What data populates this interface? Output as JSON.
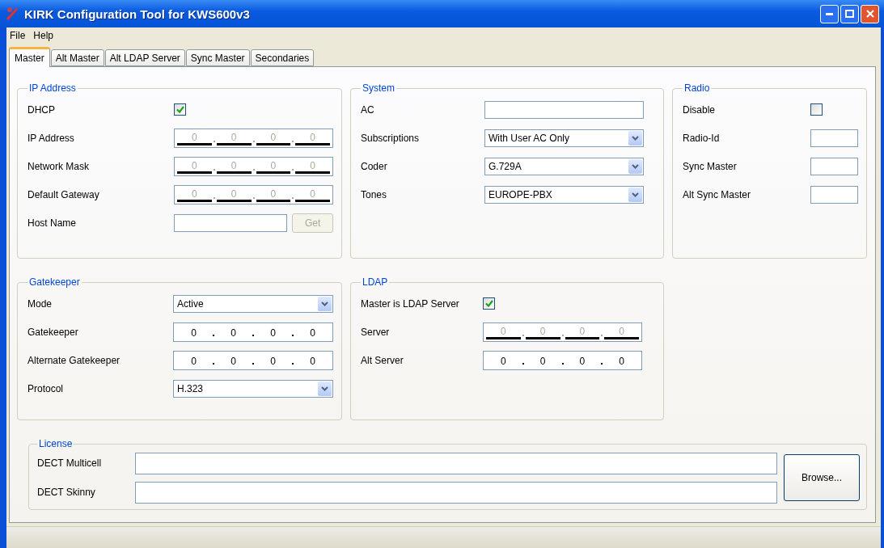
{
  "window": {
    "title": "KIRK Configuration Tool for KWS600v3"
  },
  "menu": [
    "File",
    "Help"
  ],
  "tabs": [
    {
      "label": "Master",
      "selected": true
    },
    {
      "label": "Alt Master",
      "selected": false
    },
    {
      "label": "Alt LDAP Server",
      "selected": false
    },
    {
      "label": "Sync Master",
      "selected": false
    },
    {
      "label": "Secondaries",
      "selected": false
    }
  ],
  "groups": [
    {
      "title": "IP Address",
      "rows": [
        {
          "kind": "checkbox",
          "label": "DHCP",
          "checked": true
        },
        {
          "kind": "ip",
          "label": "IP Address",
          "disabled": true,
          "octets": [
            "0",
            "0",
            "0",
            "0"
          ]
        },
        {
          "kind": "ip",
          "label": "Network Mask",
          "disabled": true,
          "octets": [
            "0",
            "0",
            "0",
            "0"
          ]
        },
        {
          "kind": "ip",
          "label": "Default Gateway",
          "disabled": true,
          "octets": [
            "0",
            "0",
            "0",
            "0"
          ]
        },
        {
          "kind": "text",
          "label": "Host Name",
          "button": {
            "label": "Get",
            "disabled": true
          }
        }
      ]
    },
    {
      "title": "System",
      "rows": [
        {
          "kind": "text",
          "label": "AC"
        },
        {
          "kind": "select",
          "label": "Subscriptions",
          "value": "With User AC Only"
        },
        {
          "kind": "select",
          "label": "Coder",
          "value": "G.729A"
        },
        {
          "kind": "select",
          "label": "Tones",
          "value": "EUROPE-PBX"
        }
      ]
    },
    {
      "title": "Radio",
      "rows": [
        {
          "kind": "checkbox",
          "label": "Disable",
          "checked": false
        },
        {
          "kind": "small",
          "label": "Radio-Id"
        },
        {
          "kind": "small",
          "label": "Sync Master"
        },
        {
          "kind": "small",
          "label": "Alt Sync Master"
        }
      ]
    },
    {
      "title": "Gatekeeper",
      "rows": [
        {
          "kind": "select",
          "label": "Mode",
          "value": "Active"
        },
        {
          "kind": "ip",
          "label": "Gatekeeper",
          "disabled": false,
          "octets": [
            "0",
            "0",
            "0",
            "0"
          ]
        },
        {
          "kind": "ip",
          "label": "Alternate Gatekeeper",
          "disabled": false,
          "octets": [
            "0",
            "0",
            "0",
            "0"
          ]
        },
        {
          "kind": "select",
          "label": "Protocol",
          "value": "H.323"
        }
      ]
    },
    {
      "title": "LDAP",
      "rows": [
        {
          "kind": "checkbox",
          "label": "Master is LDAP Server",
          "checked": true
        },
        {
          "kind": "ip",
          "label": "Server",
          "disabled": true,
          "octets": [
            "0",
            "0",
            "0",
            "0"
          ]
        },
        {
          "kind": "ip",
          "label": "Alt Server",
          "disabled": false,
          "octets": [
            "0",
            "0",
            "0",
            "0"
          ]
        }
      ]
    }
  ],
  "license": {
    "title": "License",
    "rows": [
      {
        "label": "DECT Multicell"
      },
      {
        "label": "DECT Skinny"
      }
    ],
    "button": "Browse..."
  }
}
